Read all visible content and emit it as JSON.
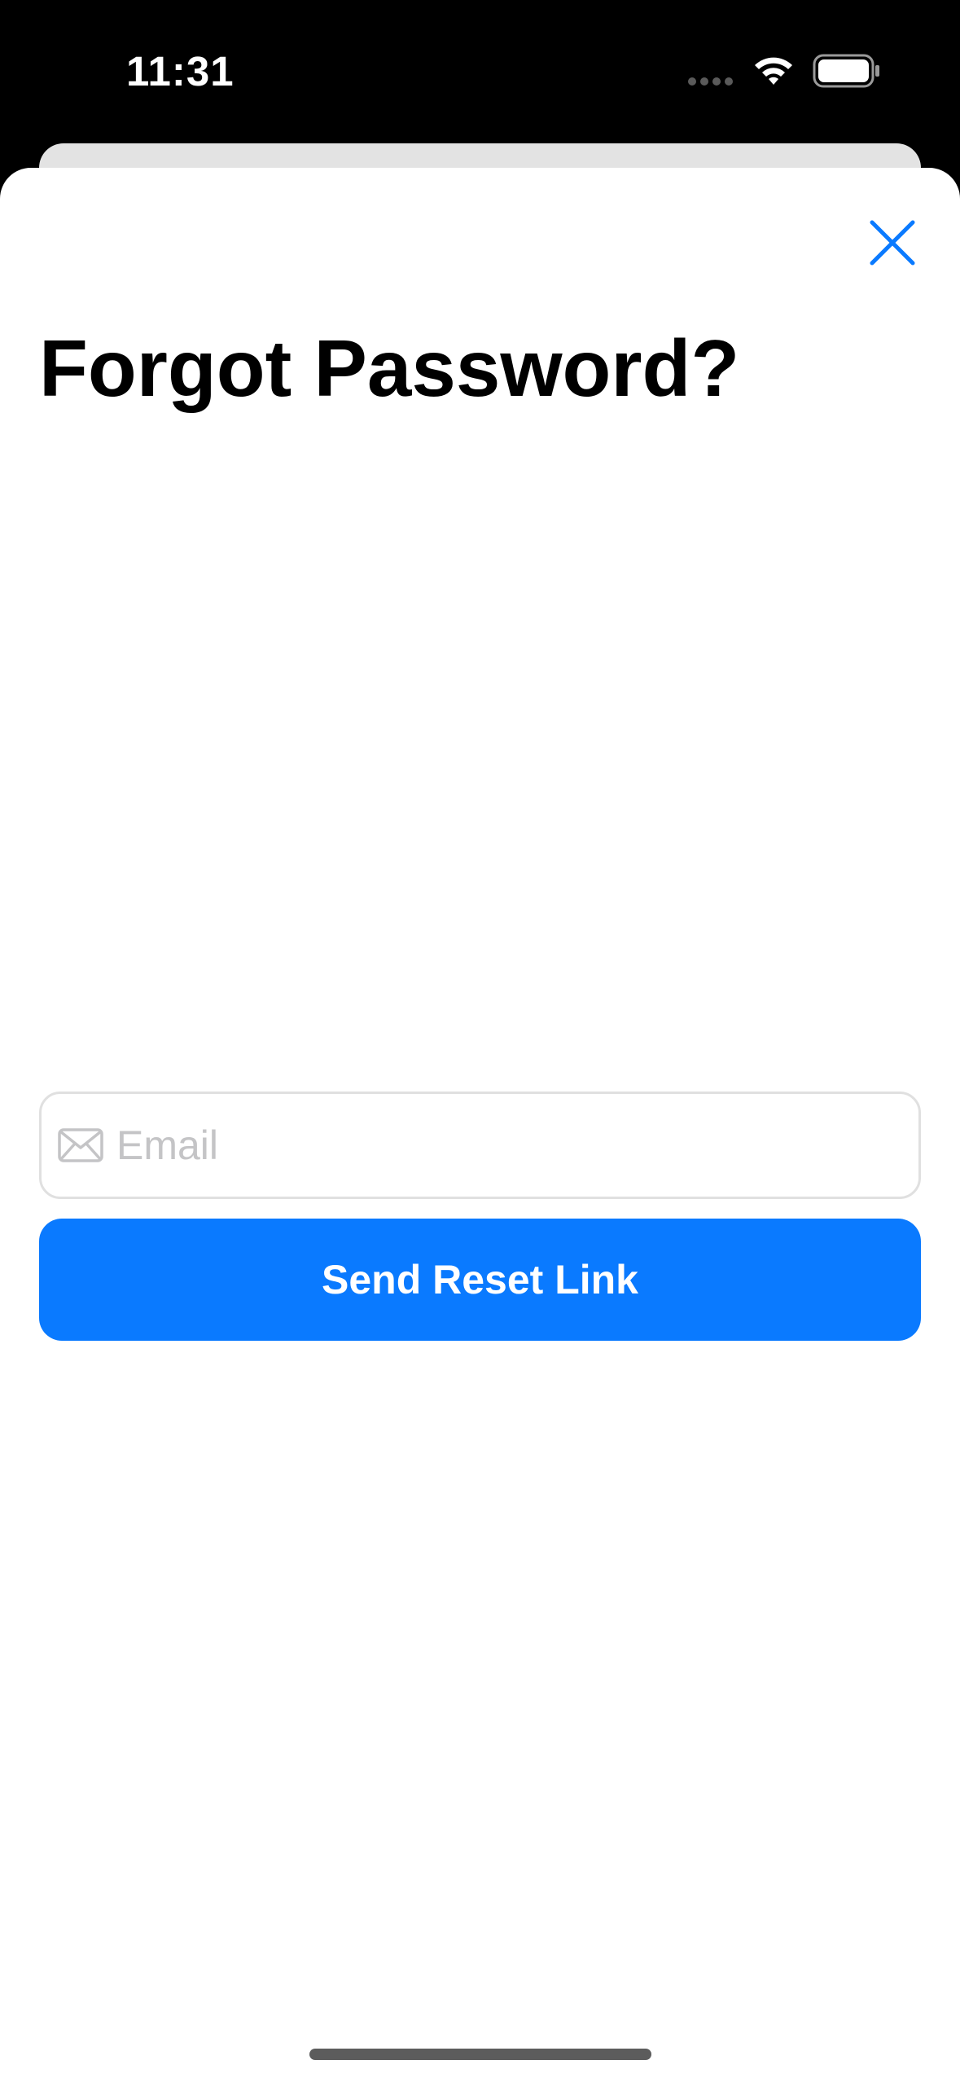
{
  "status_bar": {
    "time": "11:31",
    "icons": [
      "signal-dots-icon",
      "wifi-icon",
      "battery-icon"
    ]
  },
  "sheet": {
    "close_icon": "close-icon",
    "title": "Forgot Password?",
    "email_field": {
      "icon": "mail-icon",
      "placeholder": "Email",
      "value": ""
    },
    "send_button_label": "Send Reset Link"
  },
  "colors": {
    "accent": "#0a7aff",
    "placeholder": "#c4c4c6",
    "field_border": "#e0e0e0",
    "status_bar_bg": "#000000"
  }
}
